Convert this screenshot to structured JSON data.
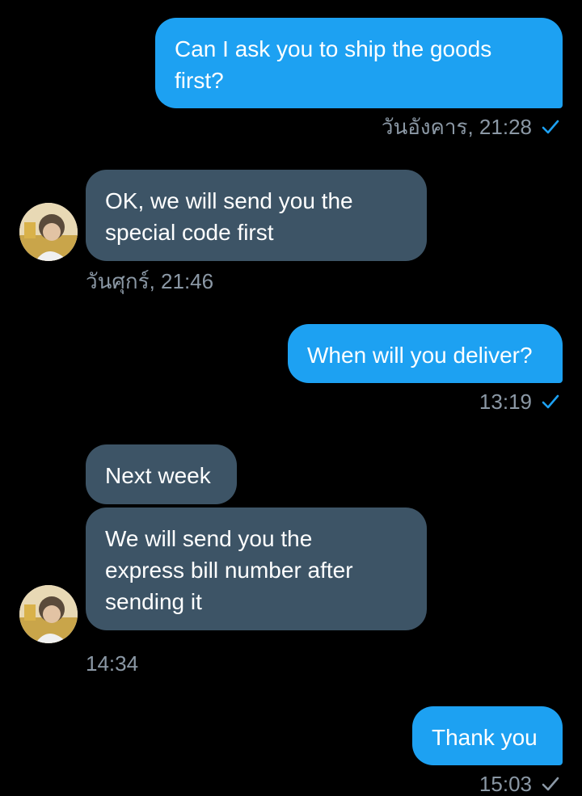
{
  "colors": {
    "background": "#000000",
    "outgoing_bubble": "#1da1f2",
    "incoming_bubble": "#3d5466",
    "timestamp_text": "#8b98a5",
    "read_check": "#1da1f2"
  },
  "icons": {
    "read_receipt": "check-icon",
    "avatar": "contact-avatar"
  },
  "messages": [
    {
      "direction": "outgoing",
      "text": "Can I ask you to ship the goods\nfirst?",
      "time": "วันอังคาร, 21:28",
      "read": true
    },
    {
      "direction": "incoming",
      "text": "OK, we will send you the\nspecial code first",
      "time": "วันศุกร์, 21:46"
    },
    {
      "direction": "outgoing",
      "text": "When will you deliver?",
      "time": "13:19",
      "read": true
    },
    {
      "direction": "incoming",
      "text": "Next week"
    },
    {
      "direction": "incoming",
      "text": "We will send you the\nexpress bill number after\nsending it",
      "time": "14:34"
    },
    {
      "direction": "outgoing",
      "text": "Thank you",
      "time": "15:03",
      "read": true
    }
  ]
}
